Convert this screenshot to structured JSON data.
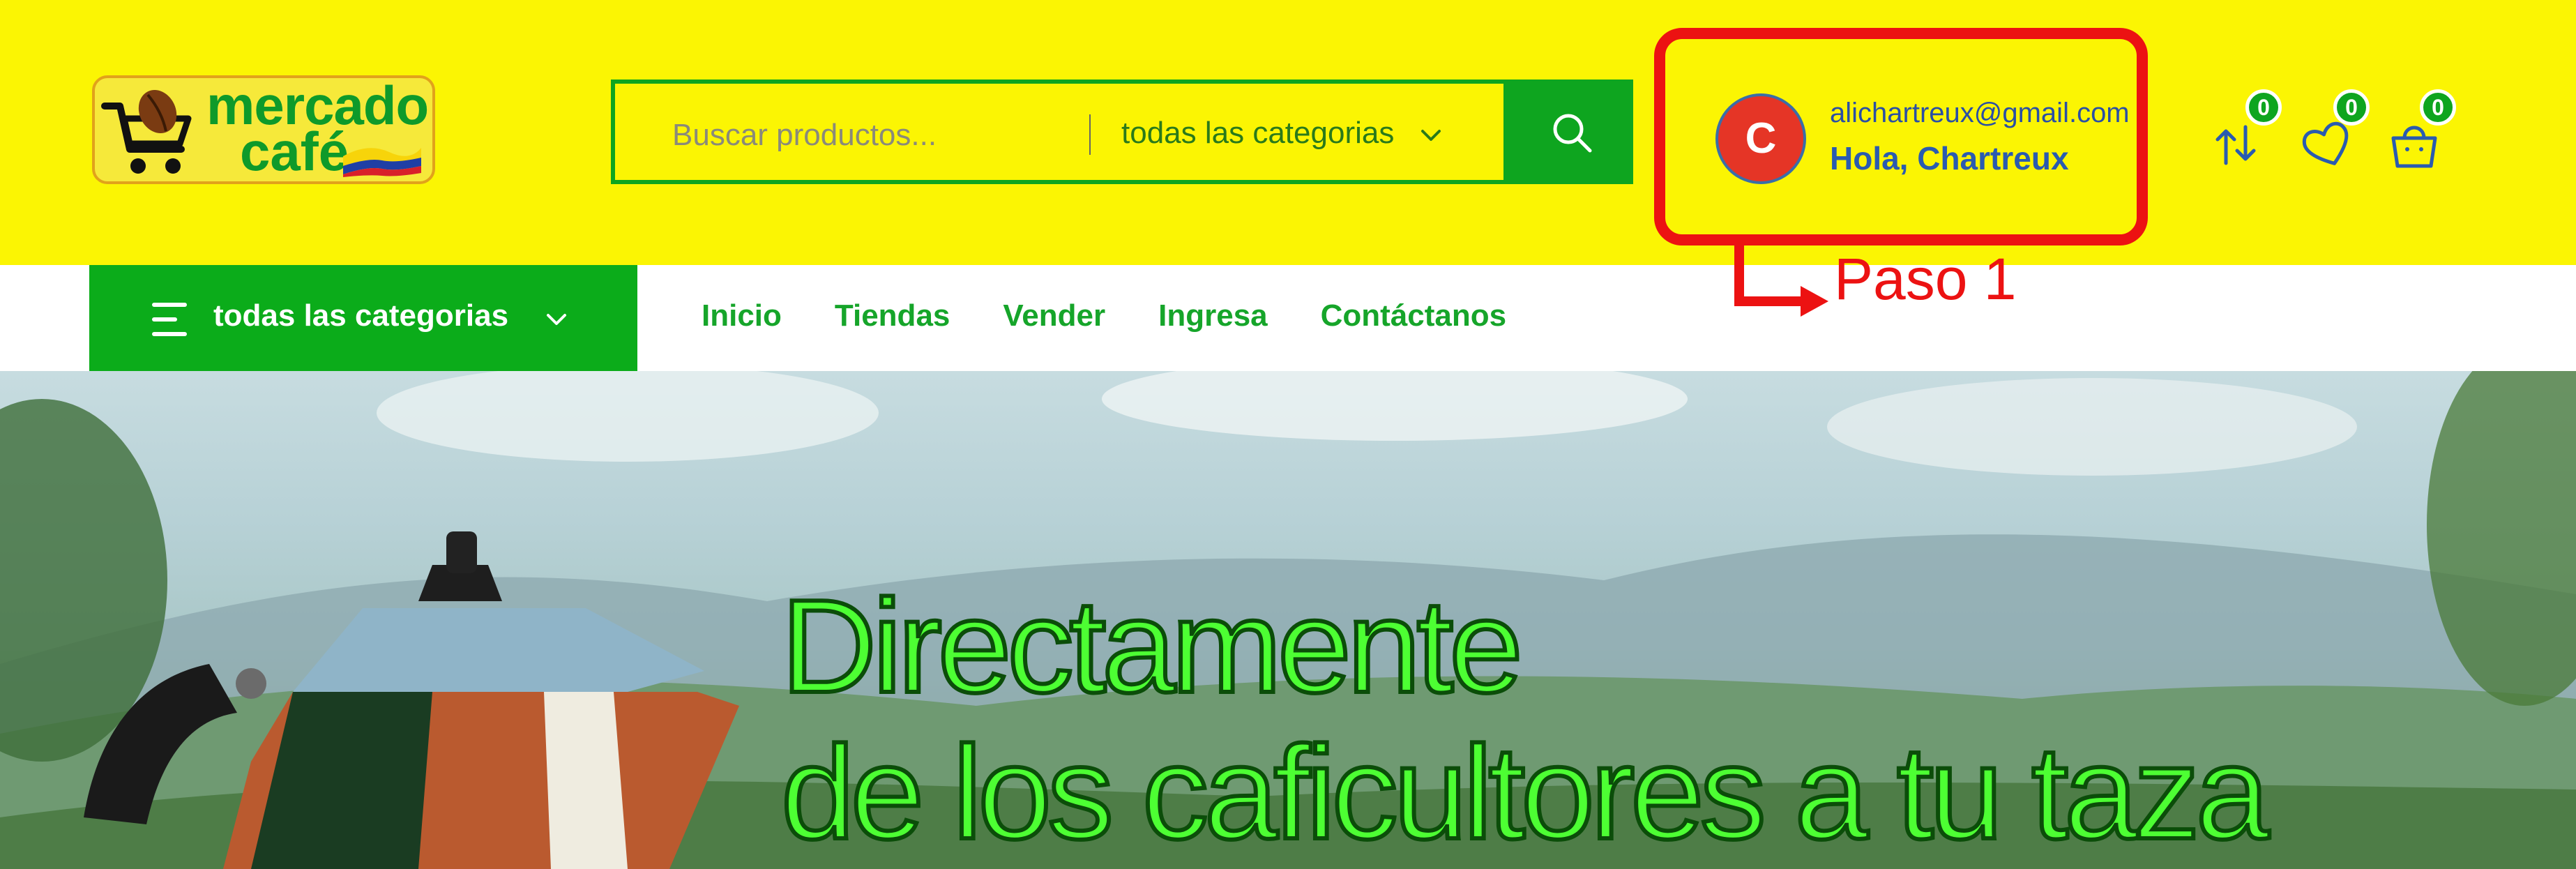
{
  "brand": {
    "logo_line1": "mercado",
    "logo_line2": "café"
  },
  "search": {
    "placeholder": "Buscar productos...",
    "category": "todas las categorias",
    "button_icon": "search-icon"
  },
  "user": {
    "avatar_initial": "C",
    "email": "alichartreux@gmail.com",
    "greeting": "Hola, Chartreux"
  },
  "header_icons": [
    {
      "name": "compare-icon",
      "count": "0"
    },
    {
      "name": "wishlist-icon",
      "count": "0"
    },
    {
      "name": "cart-icon",
      "count": "0"
    }
  ],
  "nav": {
    "all_categories": "todas las categorias",
    "links": [
      "Inicio",
      "Tiendas",
      "Vender",
      "Ingresa",
      "Contáctanos"
    ]
  },
  "annotation": {
    "label": "Paso 1"
  },
  "hero": {
    "title": "Directamente",
    "subtitle": "de los caficultores a tu taza"
  },
  "colors": {
    "header_bg": "#fbf503",
    "brand_green": "#0bac1a",
    "annotation_red": "#ec1212",
    "link_blue": "#2a5bb0"
  }
}
